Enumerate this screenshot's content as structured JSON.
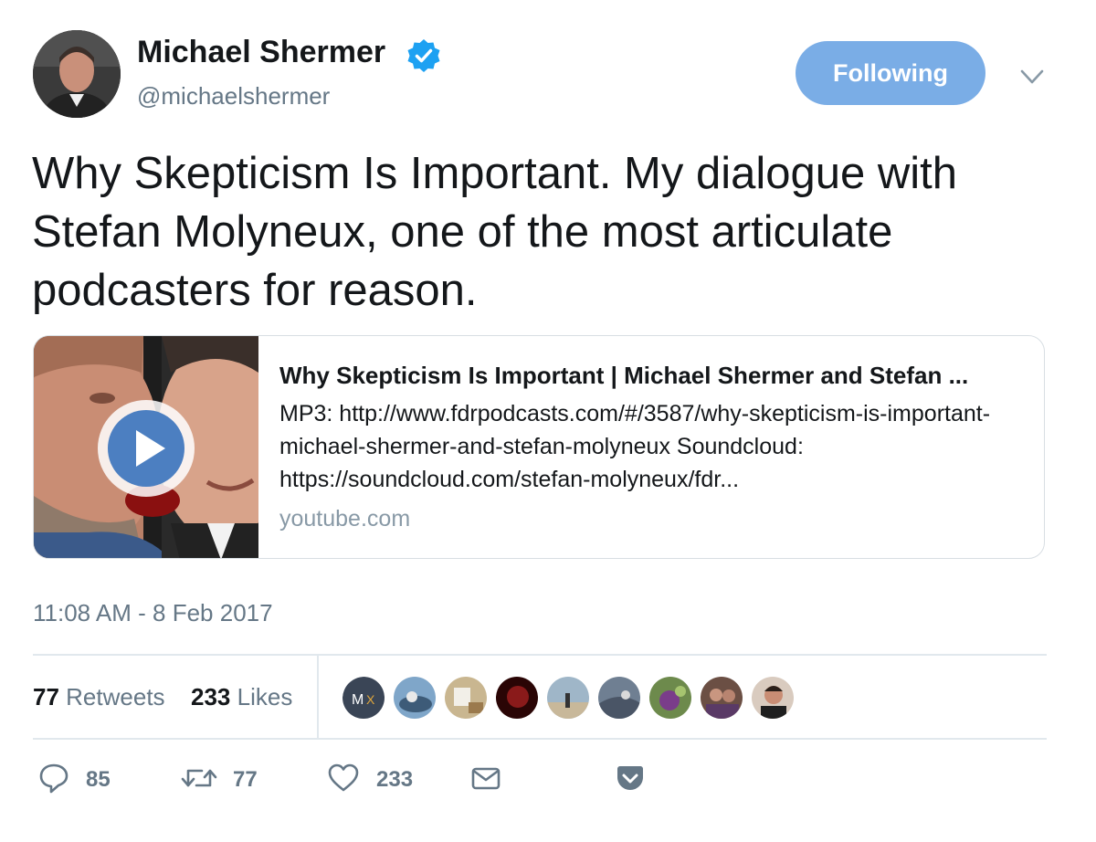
{
  "author": {
    "display_name": "Michael Shermer",
    "handle": "@michaelshermer",
    "verified": true,
    "avatar_icon": "profile-photo"
  },
  "follow_button": {
    "label": "Following"
  },
  "menu": {
    "icon": "chevron-down-icon"
  },
  "tweet": {
    "text": "Why Skepticism Is Important. My dialogue with Stefan Molyneux, one of the most articulate podcasters for reason.",
    "timestamp": "11:08 AM - 8 Feb 2017"
  },
  "card": {
    "title": "Why Skepticism Is Important | Michael Shermer and Stefan ...",
    "description": "MP3: http://www.fdrpodcasts.com/#/3587/why-skepticism-is-important-michael-shermer-and-stefan-molyneux Soundcloud: https://soundcloud.com/stefan-molyneux/fdr...",
    "domain": "youtube.com",
    "thumbnail_icon": "play-button-icon"
  },
  "stats": {
    "retweets_count": "77",
    "retweets_label": "Retweets",
    "likes_count": "233",
    "likes_label": "Likes"
  },
  "likers": [
    {
      "name": "liker-avatar-1",
      "initials": "MX",
      "color": "#3a4556"
    },
    {
      "name": "liker-avatar-2",
      "color": "#7fa6c9"
    },
    {
      "name": "liker-avatar-3",
      "color": "#c9b690"
    },
    {
      "name": "liker-avatar-4",
      "color": "#4a0d0d"
    },
    {
      "name": "liker-avatar-5",
      "color": "#9fb6c8"
    },
    {
      "name": "liker-avatar-6",
      "color": "#6f7f92"
    },
    {
      "name": "liker-avatar-7",
      "color": "#6d8a4c"
    },
    {
      "name": "liker-avatar-8",
      "color": "#6b4f44"
    },
    {
      "name": "liker-avatar-9",
      "color": "#8a6e5f"
    }
  ],
  "actions": {
    "reply_count": "85",
    "retweet_count": "77",
    "like_count": "233"
  },
  "colors": {
    "accent": "#7aade6",
    "verified": "#1da1f2",
    "text": "#14171a",
    "muted": "#657786"
  }
}
